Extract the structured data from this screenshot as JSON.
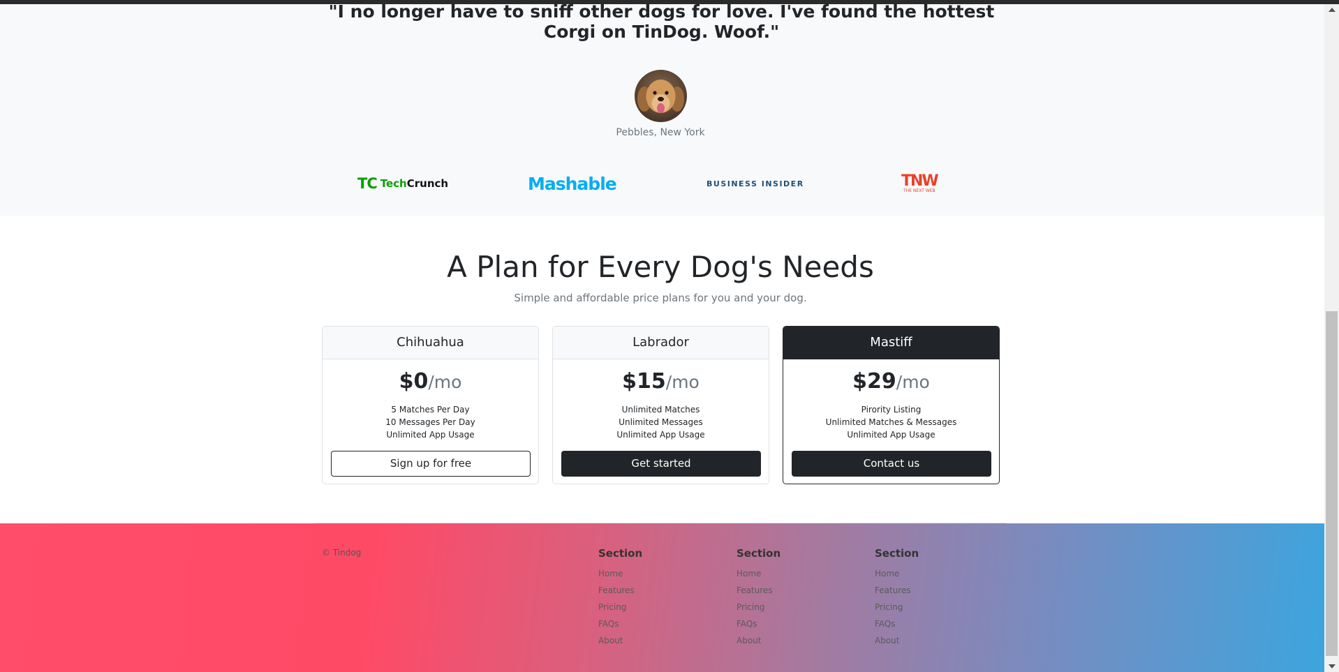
{
  "testimonial": {
    "quote": "\"I no longer have to sniff other dogs for love. I've found the hottest Corgi on TinDog. Woof.\"",
    "author": "Pebbles, New York"
  },
  "press": {
    "techcrunch": {
      "mark": "TC",
      "word1": "Tech",
      "word2": "Crunch"
    },
    "mashable": "Mashable",
    "business_insider": "BUSINESS INSIDER",
    "tnw": {
      "big": "TNW",
      "small": "THE NEXT WEB"
    }
  },
  "pricing": {
    "title": "A Plan for Every Dog's Needs",
    "subtitle": "Simple and affordable price plans for you and your dog.",
    "plans": [
      {
        "name": "Chihuahua",
        "price": "$0",
        "per": "/mo",
        "features": [
          "5 Matches Per Day",
          "10 Messages Per Day",
          "Unlimited App Usage"
        ],
        "button": "Sign up for free"
      },
      {
        "name": "Labrador",
        "price": "$15",
        "per": "/mo",
        "features": [
          "Unlimited Matches",
          "Unlimited Messages",
          "Unlimited App Usage"
        ],
        "button": "Get started"
      },
      {
        "name": "Mastiff",
        "price": "$29",
        "per": "/mo",
        "features": [
          "Pirority Listing",
          "Unlimited Matches & Messages",
          "Unlimited App Usage"
        ],
        "button": "Contact us"
      }
    ]
  },
  "footer": {
    "copyright": "© Tindog",
    "columns": [
      {
        "heading": "Section",
        "links": [
          "Home",
          "Features",
          "Pricing",
          "FAQs",
          "About"
        ]
      },
      {
        "heading": "Section",
        "links": [
          "Home",
          "Features",
          "Pricing",
          "FAQs",
          "About"
        ]
      },
      {
        "heading": "Section",
        "links": [
          "Home",
          "Features",
          "Pricing",
          "FAQs",
          "About"
        ]
      }
    ]
  },
  "colors": {
    "gradient_start": "#ff4a66",
    "gradient_end": "#3da5de",
    "dark": "#212529",
    "mashable_blue": "#00aeef",
    "techcrunch_green": "#0a9e01",
    "tnw_red": "#e8412b"
  },
  "icons": {
    "avatar": "golden-retriever-avatar",
    "scroll_up": "arrow-up-icon",
    "scroll_down": "arrow-down-icon"
  }
}
